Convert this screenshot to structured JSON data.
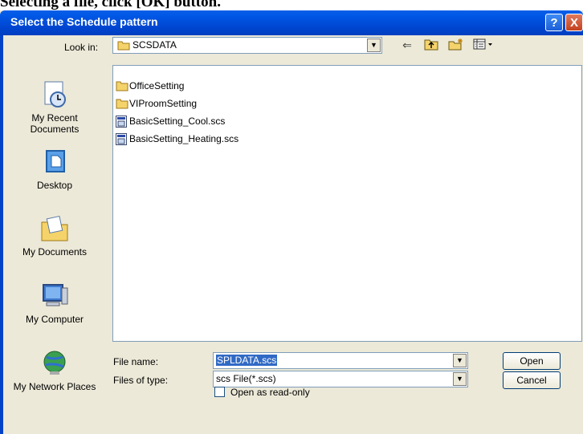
{
  "background_text": "Selecting a file, click [OK] button.",
  "dialog": {
    "title": "Select the Schedule pattern",
    "help_glyph": "?",
    "close_glyph": "X"
  },
  "toolbar": {
    "look_in_label": "Look in:",
    "look_in_value": "SCSDATA",
    "icons": [
      "back-icon",
      "up-folder-icon",
      "new-folder-icon",
      "view-menu-icon"
    ]
  },
  "places": [
    {
      "label": "My Recent Documents",
      "icon": "recent-documents-icon"
    },
    {
      "label": "Desktop",
      "icon": "desktop-icon"
    },
    {
      "label": "My Documents",
      "icon": "my-documents-icon"
    },
    {
      "label": "My Computer",
      "icon": "my-computer-icon"
    },
    {
      "label": "My Network Places",
      "icon": "network-places-icon"
    }
  ],
  "files": [
    {
      "name": "OfficeSetting",
      "type": "folder"
    },
    {
      "name": "VIProomSetting",
      "type": "folder"
    },
    {
      "name": "BasicSetting_Cool.scs",
      "type": "file"
    },
    {
      "name": "BasicSetting_Heating.scs",
      "type": "file"
    }
  ],
  "form": {
    "file_name_label": "File name:",
    "file_name_value": "SPLDATA.scs",
    "file_type_label": "Files of type:",
    "file_type_value": "scs File(*.scs)",
    "read_only_label": "Open as read-only",
    "read_only_checked": false
  },
  "buttons": {
    "open": "Open",
    "cancel": "Cancel"
  },
  "colors": {
    "titlebar": "#0054e3",
    "dialog_bg": "#ece9d8",
    "selection": "#316ac5"
  }
}
